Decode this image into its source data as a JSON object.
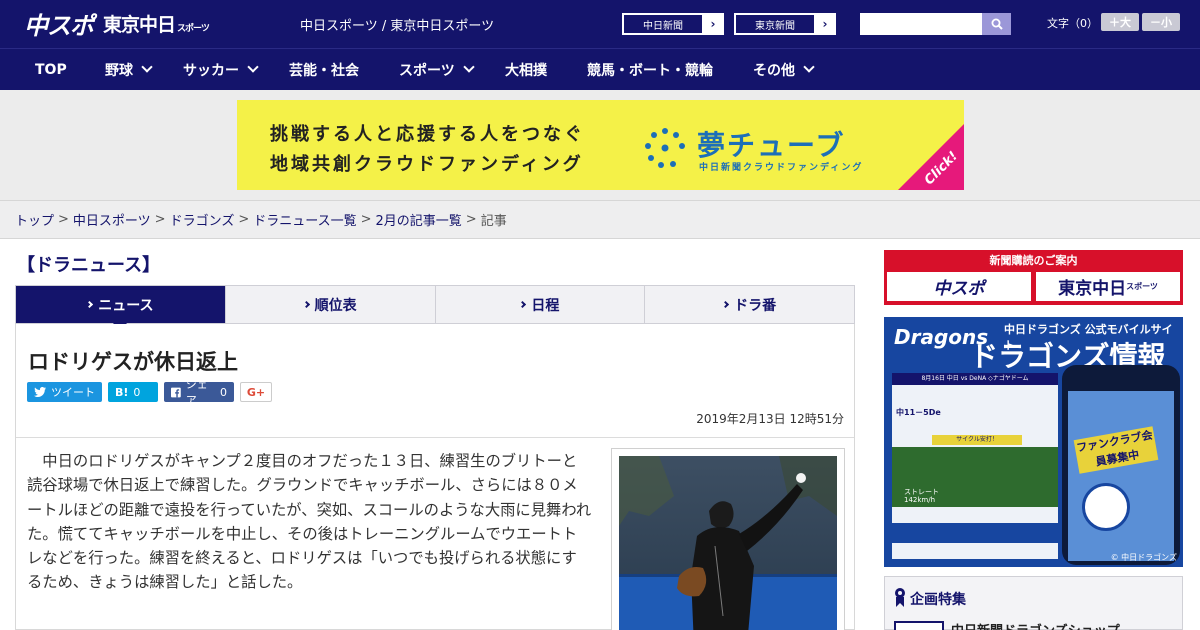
{
  "header": {
    "logo_main": "中スポ",
    "logo_sub": "東京中日",
    "logo_sub_small": "スポーツ",
    "site_name": "中日スポーツ / 東京中日スポーツ",
    "paper_links": [
      {
        "label": "中日新聞",
        "arrow": "›"
      },
      {
        "label": "東京新聞",
        "arrow": "›"
      }
    ],
    "search": {
      "placeholder": "",
      "icon": "search-icon"
    },
    "font_size": {
      "label": "文字（0）",
      "larger": "＋大",
      "smaller": "－小"
    }
  },
  "nav": {
    "items": [
      {
        "label": "TOP",
        "dropdown": false
      },
      {
        "label": "野球",
        "dropdown": true
      },
      {
        "label": "サッカー",
        "dropdown": true
      },
      {
        "label": "芸能・社会",
        "dropdown": false
      },
      {
        "label": "スポーツ",
        "dropdown": true
      },
      {
        "label": "大相撲",
        "dropdown": false
      },
      {
        "label": "競馬・ボート・競輪",
        "dropdown": false
      },
      {
        "label": "その他",
        "dropdown": true
      }
    ]
  },
  "ad": {
    "line1": "挑戦する人と応援する人をつなぐ",
    "line2": "地域共創クラウドファンディング",
    "brand": "夢チューブ",
    "brand_sub": "中日新聞クラウドファンディング",
    "click": "Click!",
    "colors": {
      "background": "#f4f148",
      "brand": "#1c6fb8",
      "corner": "#e6197b"
    }
  },
  "breadcrumb": {
    "items": [
      "トップ",
      "中日スポーツ",
      "ドラゴンズ",
      "ドラニュース一覧",
      "2月の記事一覧"
    ],
    "current": "記事",
    "separator": ">"
  },
  "section": {
    "title": "【ドラニュース】"
  },
  "tabs": [
    {
      "label": "ニュース",
      "active": true
    },
    {
      "label": "順位表",
      "active": false
    },
    {
      "label": "日程",
      "active": false
    },
    {
      "label": "ドラ番",
      "active": false
    }
  ],
  "article": {
    "title": "ロドリゲスが休日返上",
    "share": {
      "tweet": "ツイート",
      "hatena_label": "B!",
      "hatena_count": "0",
      "facebook": "シェア",
      "facebook_count": "0",
      "gplus": "G+"
    },
    "date": "2019年2月13日 12時51分",
    "body": "中日のロドリゲスがキャンプ２度目のオフだった１３日、練習生のブリトーと読谷球場で休日返上で練習した。グラウンドでキャッチボール、さらには８０メートルほどの距離で遠投を行っていたが、突如、スコールのような大雨に見舞われた。慌ててキャッチボールを中止し、その後はトレーニングルームでウエートトレなどを行った。練習を終えると、ロドリゲスは「いつでも投げられる状態にするため、きょうは練習した」と話した。"
  },
  "sidebar": {
    "subscribe": {
      "title": "新聞購読のご案内",
      "logo1": "中スポ",
      "logo2": "東京中日",
      "logo2_small": "スポーツ"
    },
    "dragons_ad": {
      "brand": "Dragons",
      "line1": "中日ドラゴンズ 公式モバイルサイト",
      "line2": "ドラゴンズ情報",
      "score_line": "8月16日 中日 vs DeNA ◇ナゴヤドーム",
      "score": "中11－5De",
      "cycle": "サイクル安打！",
      "straight": "ストレート",
      "speed": "142km/h",
      "fanclub": "ファンクラブ会員募集中",
      "copyright": "© 中日ドラゴンズ"
    },
    "kikaku": {
      "title": "企画特集",
      "item": "中日新聞ドラゴンズショップ"
    }
  }
}
